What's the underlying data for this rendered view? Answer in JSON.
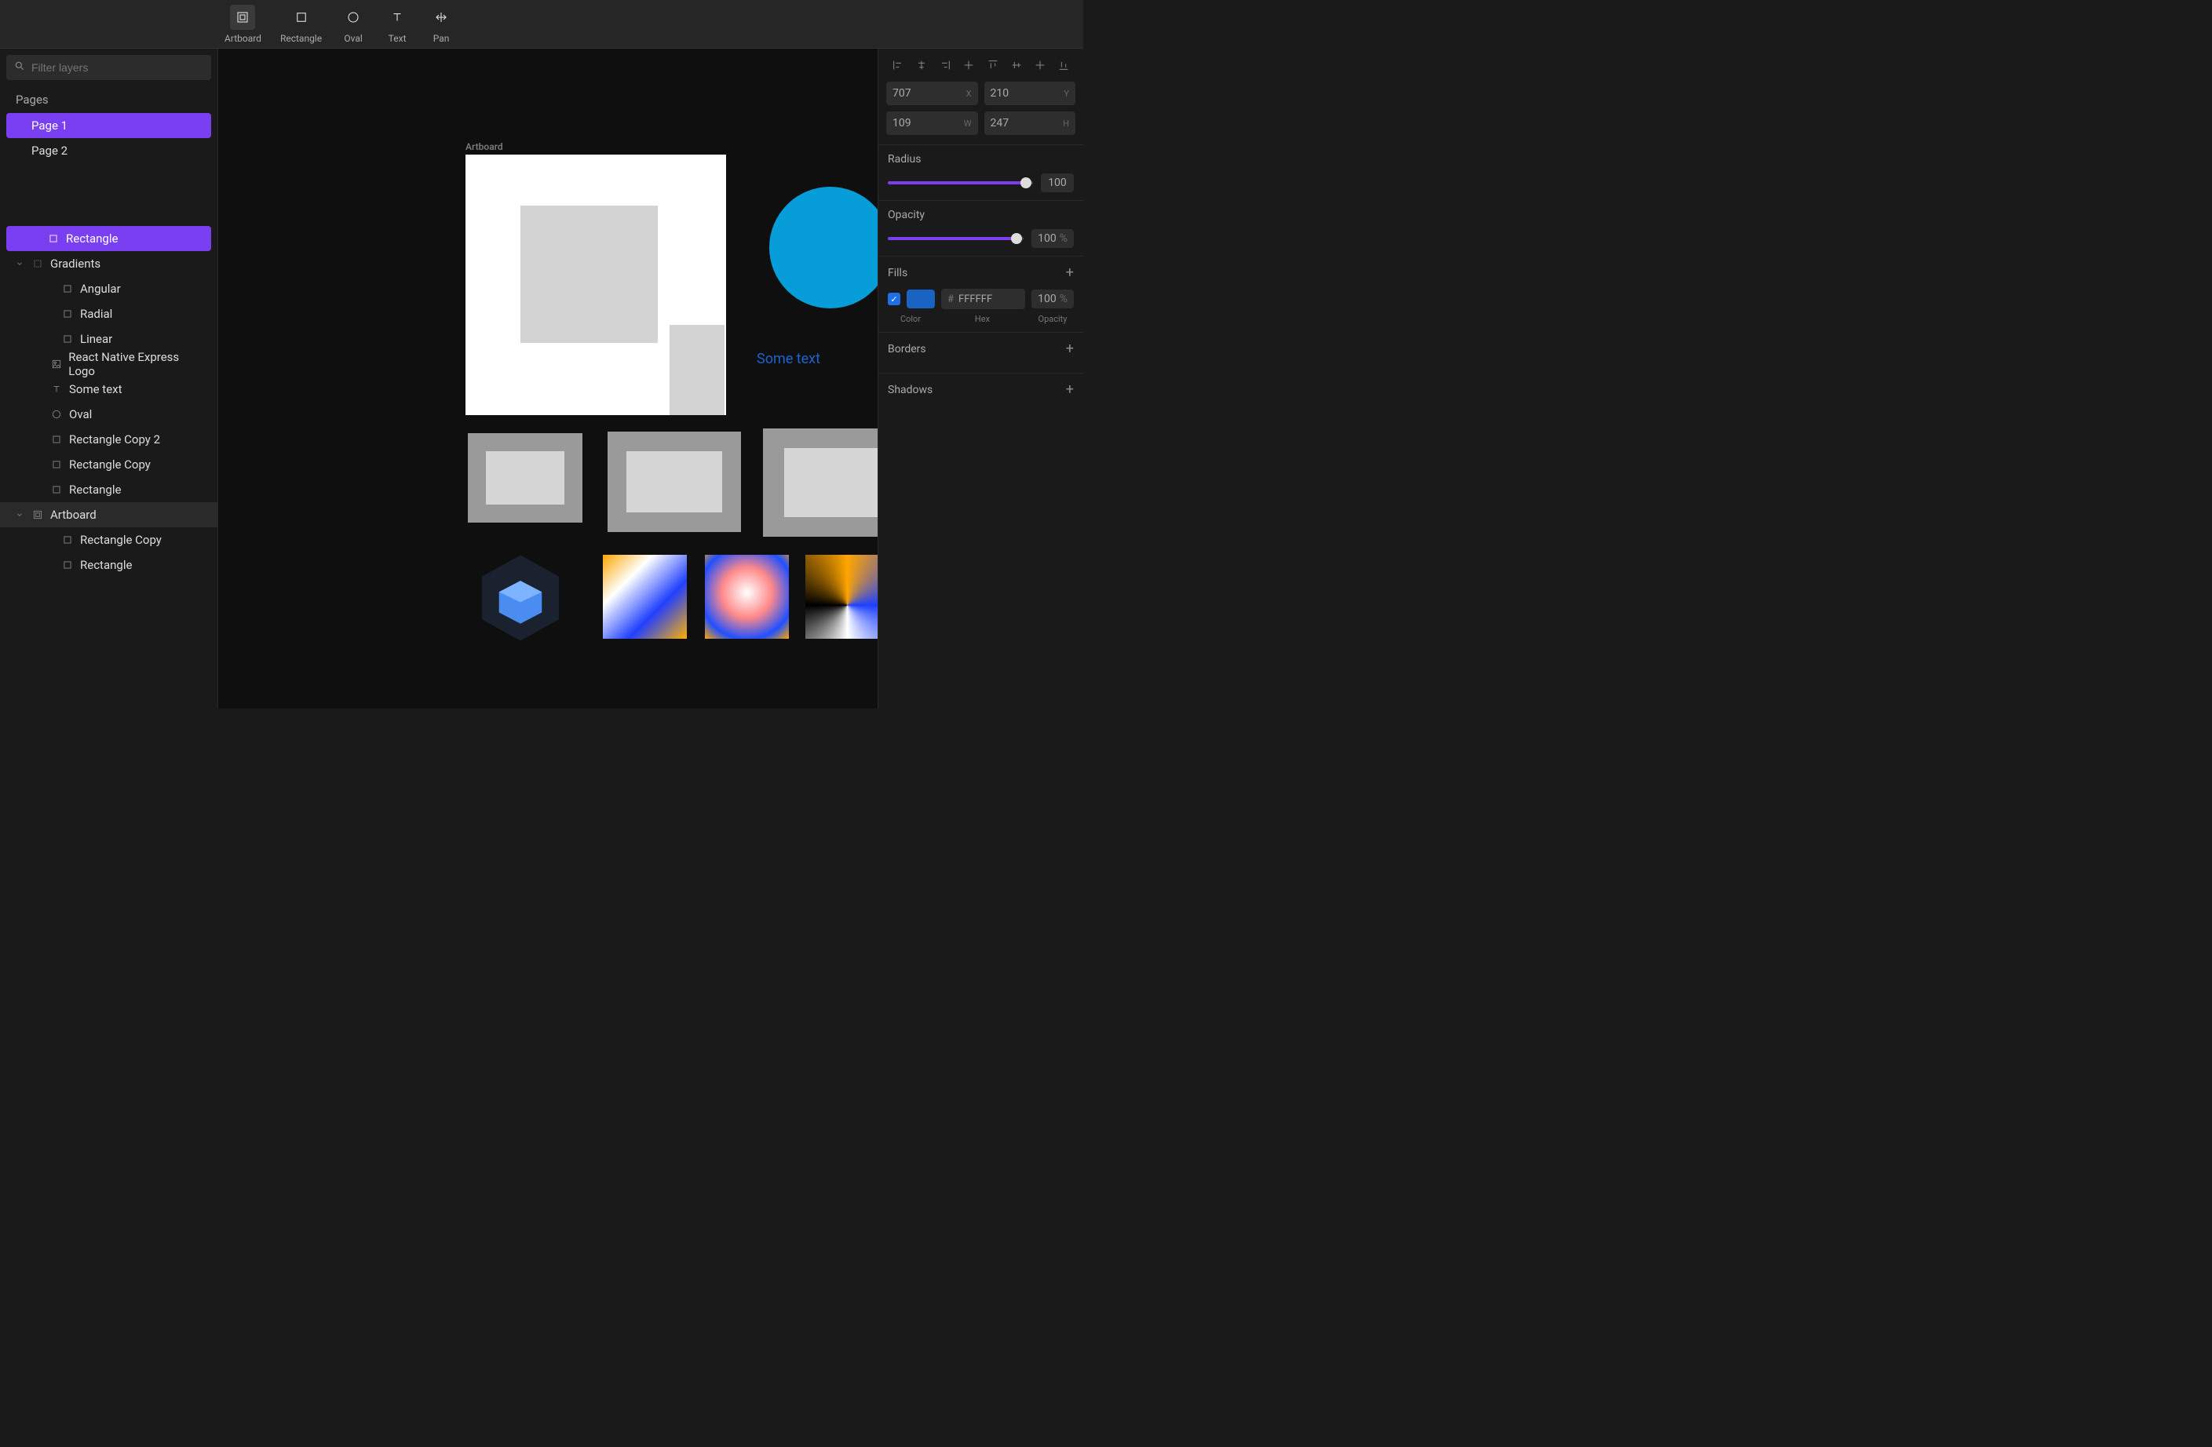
{
  "toolbar": {
    "tools": [
      {
        "label": "Artboard",
        "icon": "artboard",
        "active": true
      },
      {
        "label": "Rectangle",
        "icon": "rectangle",
        "active": false
      },
      {
        "label": "Oval",
        "icon": "oval",
        "active": false
      },
      {
        "label": "Text",
        "icon": "text",
        "active": false
      },
      {
        "label": "Pan",
        "icon": "pan",
        "active": false
      }
    ]
  },
  "sidebar": {
    "filter_placeholder": "Filter layers",
    "pages_label": "Pages",
    "pages": [
      {
        "label": "Page 1",
        "selected": true
      },
      {
        "label": "Page 2",
        "selected": false
      }
    ],
    "layers": [
      {
        "label": "Rectangle",
        "icon": "rect",
        "indent": 2,
        "selected": true
      },
      {
        "label": "Gradients",
        "icon": "group",
        "indent": 1,
        "chevron": "down"
      },
      {
        "label": "Angular",
        "icon": "rect",
        "indent": 3
      },
      {
        "label": "Radial",
        "icon": "rect",
        "indent": 3
      },
      {
        "label": "Linear",
        "icon": "rect",
        "indent": 3
      },
      {
        "label": "React Native Express Logo",
        "icon": "image",
        "indent": 2
      },
      {
        "label": "Some text",
        "icon": "text",
        "indent": 2
      },
      {
        "label": "Oval",
        "icon": "oval",
        "indent": 2
      },
      {
        "label": "Rectangle Copy 2",
        "icon": "rect",
        "indent": 2
      },
      {
        "label": "Rectangle Copy",
        "icon": "rect",
        "indent": 2
      },
      {
        "label": "Rectangle",
        "icon": "rect",
        "indent": 2
      },
      {
        "label": "Artboard",
        "icon": "artboard",
        "indent": 1,
        "chevron": "down",
        "class": "artboard-row"
      },
      {
        "label": "Rectangle Copy",
        "icon": "rect",
        "indent": 3
      },
      {
        "label": "Rectangle",
        "icon": "rect",
        "indent": 3
      }
    ]
  },
  "canvas": {
    "artboard_label": "Artboard",
    "some_text": "Some text"
  },
  "inspector": {
    "x": "707",
    "y": "210",
    "w": "109",
    "h": "247",
    "radius_label": "Radius",
    "radius_value": "100",
    "opacity_label": "Opacity",
    "opacity_value": "100",
    "opacity_unit": "%",
    "fills_label": "Fills",
    "fill_hex": "FFFFFF",
    "fill_opacity": "100",
    "fill_opacity_unit": "%",
    "fill_swatch_color": "#1863c4",
    "fill_labels": {
      "color": "Color",
      "hex": "Hex",
      "opacity": "Opacity"
    },
    "borders_label": "Borders",
    "shadows_label": "Shadows"
  }
}
